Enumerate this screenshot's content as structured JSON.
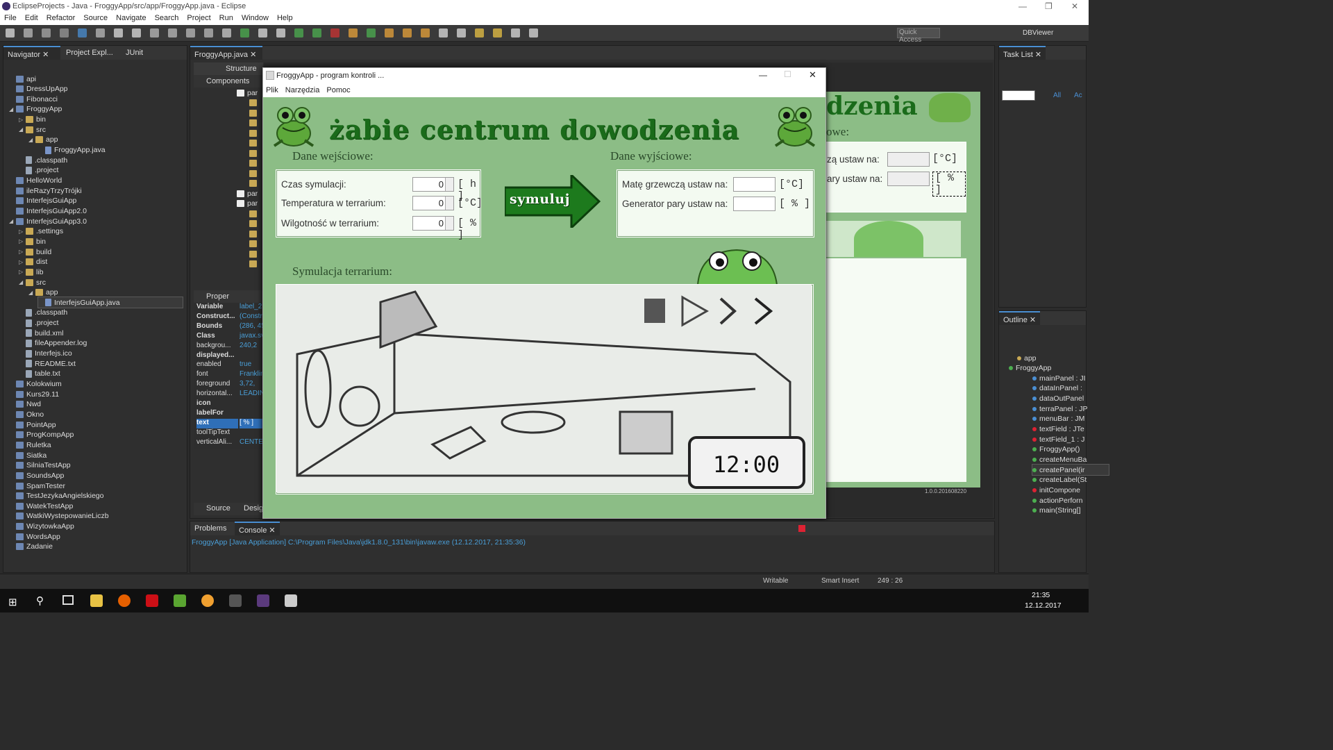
{
  "window": {
    "title": "EclipseProjects - Java - FroggyApp/src/app/FroggyApp.java - Eclipse"
  },
  "menu": [
    "File",
    "Edit",
    "Refactor",
    "Source",
    "Navigate",
    "Search",
    "Project",
    "Run",
    "Window",
    "Help"
  ],
  "toolbar": {
    "quick_access": "Quick Access",
    "dbviewer": "DBViewer"
  },
  "navigator": {
    "tabs": [
      "Navigator",
      "Project Expl...",
      "JUnit"
    ],
    "items": [
      "api",
      "DressUpApp",
      "Fibonacci",
      "FroggyApp",
      "bin",
      "src",
      "app",
      "FroggyApp.java",
      ".classpath",
      ".project",
      "HelloWorld",
      "ileRazyTrzyTrójki",
      "InterfejsGuiApp",
      "InterfejsGuiApp2.0",
      "InterfejsGuiApp3.0",
      ".settings",
      "bin",
      "build",
      "dist",
      "lib",
      "src",
      "app",
      "InterfejsGuiApp.java",
      ".classpath",
      ".project",
      "build.xml",
      "fileAppender.log",
      "Interfejs.ico",
      "README.txt",
      "table.txt",
      "Kolokwium",
      "Kurs29.11",
      "Nwd",
      "Okno",
      "PointApp",
      "ProgKompApp",
      "Ruletka",
      "Siatka",
      "SilniaTestApp",
      "SoundsApp",
      "SpamTester",
      "TestJezykaAngielskiego",
      "WatekTestApp",
      "WatkiWystepowanieLiczb",
      "WizytowkaApp",
      "WordsApp",
      "Zadanie"
    ]
  },
  "editor": {
    "tab": "FroggyApp.java",
    "structure": "Structure",
    "components": "Components",
    "par": "par",
    "bottom_tabs": [
      "Source",
      "Design"
    ],
    "properties_tab": "Proper"
  },
  "properties": [
    {
      "k": "Variable",
      "v": "label_2"
    },
    {
      "k": "Construct...",
      "v": "(Constr"
    },
    {
      "k": "Bounds",
      "v": "(286, 45"
    },
    {
      "k": "Class",
      "v": "javax.sv"
    },
    {
      "k": "backgrou...",
      "v": "240,2"
    },
    {
      "k": "displayed...",
      "v": ""
    },
    {
      "k": "enabled",
      "v": "true"
    },
    {
      "k": "font",
      "v": "Franklin"
    },
    {
      "k": "foreground",
      "v": "3,72,"
    },
    {
      "k": "horizontal...",
      "v": "LEADIN"
    },
    {
      "k": "icon",
      "v": ""
    },
    {
      "k": "labelFor",
      "v": ""
    },
    {
      "k": "text",
      "v": "[ % ]"
    },
    {
      "k": "toolTipText",
      "v": ""
    },
    {
      "k": "verticalAli...",
      "v": "CENTER"
    }
  ],
  "froggy": {
    "title": "FroggyApp - program kontroli ...",
    "menu": [
      "Plik",
      "Narzędzia",
      "Pomoc"
    ],
    "banner": "żabie centrum dowodzenia",
    "input_title": "Dane wejściowe:",
    "output_title": "Dane wyjściowe:",
    "inputs": [
      {
        "label": "Czas symulacji:",
        "value": "0",
        "unit": "[ h ]"
      },
      {
        "label": "Temperatura w terrarium:",
        "value": "0",
        "unit": "[°C]"
      },
      {
        "label": "Wilgotność w terrarium:",
        "value": "0",
        "unit": "[ % ]"
      }
    ],
    "outputs": [
      {
        "label": "Matę grzewczą ustaw na:",
        "unit": "[°C]"
      },
      {
        "label": "Generator pary ustaw na:",
        "unit": "[ % ]"
      }
    ],
    "simulate": "symuluj",
    "sim_title": "Symulacja terrarium:",
    "clock": "12:00"
  },
  "background_design": {
    "banner_part": "dzenia",
    "title_part": "owe:",
    "row1": "zą ustaw na:",
    "row1_unit": "[°C]",
    "row2": "ary ustaw na:",
    "row2_unit": "[ % ]",
    "version": "1.0.0.201608220"
  },
  "task_list": {
    "tab": "Task List",
    "all": "All",
    "act": "Ac"
  },
  "outline": {
    "tab": "Outline",
    "items": [
      "app",
      "FroggyApp",
      "mainPanel : JI",
      "dataInPanel :",
      "dataOutPanel",
      "terraPanel : JP",
      "menuBar : JM",
      "textField : JTe",
      "textField_1 : J",
      "FroggyApp()",
      "createMenuBa",
      "createPanel(ir",
      "createLabel(St",
      "initCompone",
      "actionPerforn",
      "main(String[]"
    ]
  },
  "console": {
    "tabs": [
      "Problems",
      "Console"
    ],
    "line": "FroggyApp [Java Application] C:\\Program Files\\Java\\jdk1.8.0_131\\bin\\javaw.exe (12.12.2017, 21:35:36)"
  },
  "status": {
    "writable": "Writable",
    "insert": "Smart Insert",
    "pos": "249 : 26"
  },
  "taskbar": {
    "time": "21:35",
    "date": "12.12.2017"
  }
}
